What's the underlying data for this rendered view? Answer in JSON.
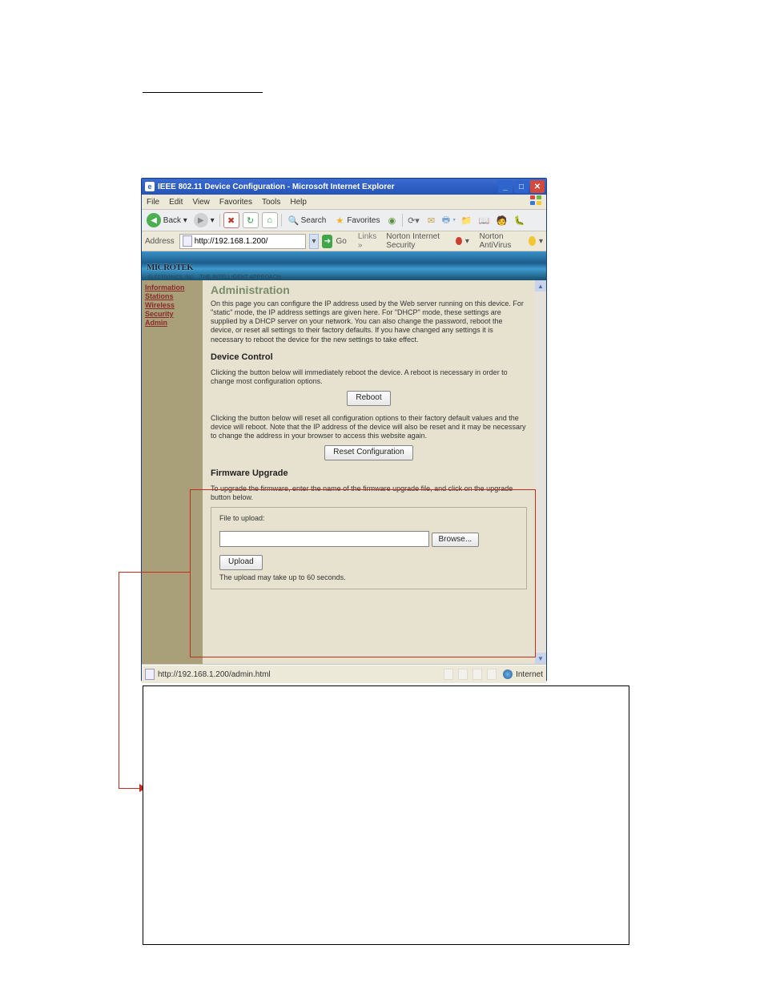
{
  "window": {
    "title": "IEEE 802.11 Device Configuration - Microsoft Internet Explorer"
  },
  "menu": {
    "file": "File",
    "edit": "Edit",
    "view": "View",
    "favorites": "Favorites",
    "tools": "Tools",
    "help": "Help"
  },
  "toolbar": {
    "back": "Back",
    "forward": "",
    "stop": "✕",
    "refresh": "↻",
    "home": "⌂",
    "search": "Search",
    "favorites": "Favorites",
    "go_label": "Go"
  },
  "address": {
    "label": "Address",
    "url": "http://192.168.1.200/",
    "go": "Go",
    "links": "Links",
    "nis": "Norton Internet Security",
    "nav": "Norton AntiVirus"
  },
  "banner": {
    "logo": "MICROTEK",
    "sub": "ELECTRONICS, INC.",
    "tagline": "THE INTELLIGENT APPROACH"
  },
  "sidebar": {
    "items": [
      {
        "label": "Information"
      },
      {
        "label": "Stations"
      },
      {
        "label": "Wireless"
      },
      {
        "label": "Security"
      },
      {
        "label": "Admin"
      }
    ]
  },
  "admin": {
    "heading": "Administration",
    "intro": "On this page you can configure the IP address used by the Web server running on this device. For \"static\" mode, the IP address settings are given here. For \"DHCP\" mode, these settings are supplied by a DHCP server on your network. You can also change the password, reboot the device, or reset all settings to their factory defaults. If you have changed any settings it is necessary to reboot the device for the new settings to take effect.",
    "device_control_title": "Device Control",
    "reboot_text": "Clicking the button below will immediately reboot the device. A reboot is necessary in order to change most configuration options.",
    "reboot_btn": "Reboot",
    "reset_text": "Clicking the button below will reset all configuration options to their factory default values and the device will reboot. Note that the IP address of the device will also be reset and it may be necessary to change the address in your browser to access this website again.",
    "reset_btn": "Reset Configuration",
    "firmware_title": "Firmware Upgrade",
    "firmware_text": "To upgrade the firmware, enter the name of the firmware upgrade file, and click on the upgrade button below.",
    "file_label": "File to upload:",
    "browse_btn": "Browse...",
    "upload_btn": "Upload",
    "upload_note": "The upload may take up to 60 seconds."
  },
  "status": {
    "url": "http://192.168.1.200/admin.html",
    "zone": "Internet"
  }
}
